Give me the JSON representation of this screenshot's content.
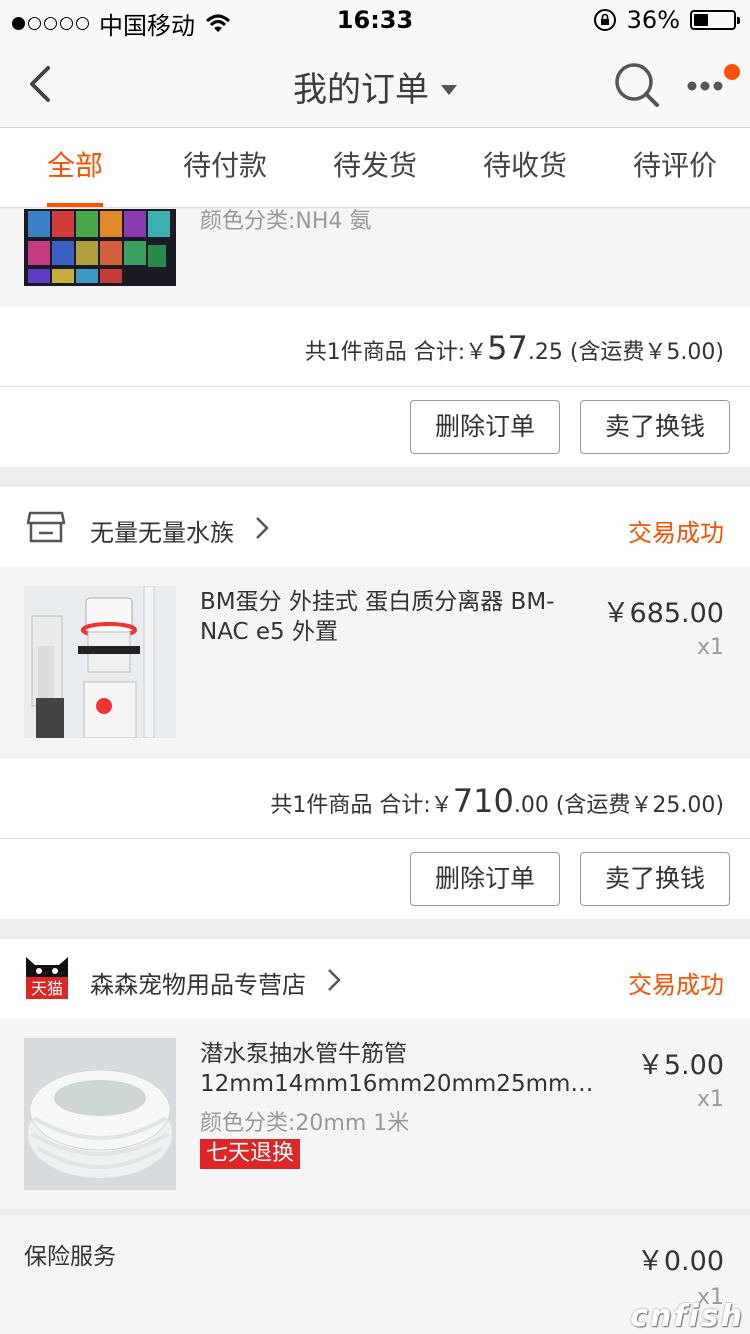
{
  "status_bar": {
    "carrier": "中国移动",
    "time": "16:33",
    "battery": "36%",
    "battery_level": 0.36
  },
  "nav": {
    "title": "我的订单"
  },
  "tabs": [
    "全部",
    "待付款",
    "待发货",
    "待收货",
    "待评价"
  ],
  "orders": [
    {
      "variant": "颜色分类:NH4 氨",
      "summary_prefix": "共1件商品 合计:￥",
      "total_int": "57",
      "total_dec": ".25",
      "summary_suffix": " (含运费￥5.00)",
      "delete_label": "删除订单",
      "sell_label": "卖了换钱"
    },
    {
      "shop": "无量无量水族",
      "status": "交易成功",
      "item_title": "BM蛋分 外挂式 蛋白质分离器 BM-NAC e5 外置",
      "price": "￥685.00",
      "qty": "x1",
      "summary_prefix": "共1件商品 合计:￥",
      "total_int": "710",
      "total_dec": ".00",
      "summary_suffix": " (含运费￥25.00)",
      "delete_label": "删除订单",
      "sell_label": "卖了换钱"
    },
    {
      "shop": "森森宠物用品专营店",
      "shop_badge": "天猫",
      "status": "交易成功",
      "item_title": "潜水泵抽水管牛筋管 12mm14mm16mm20mm25mm…",
      "variant": "颜色分类:20mm 1米",
      "badge": "七天退换",
      "price": "￥5.00",
      "qty": "x1",
      "service_label": "保险服务",
      "service_price": "￥0.00",
      "service_qty": "x1"
    }
  ],
  "watermark": "cnfish"
}
